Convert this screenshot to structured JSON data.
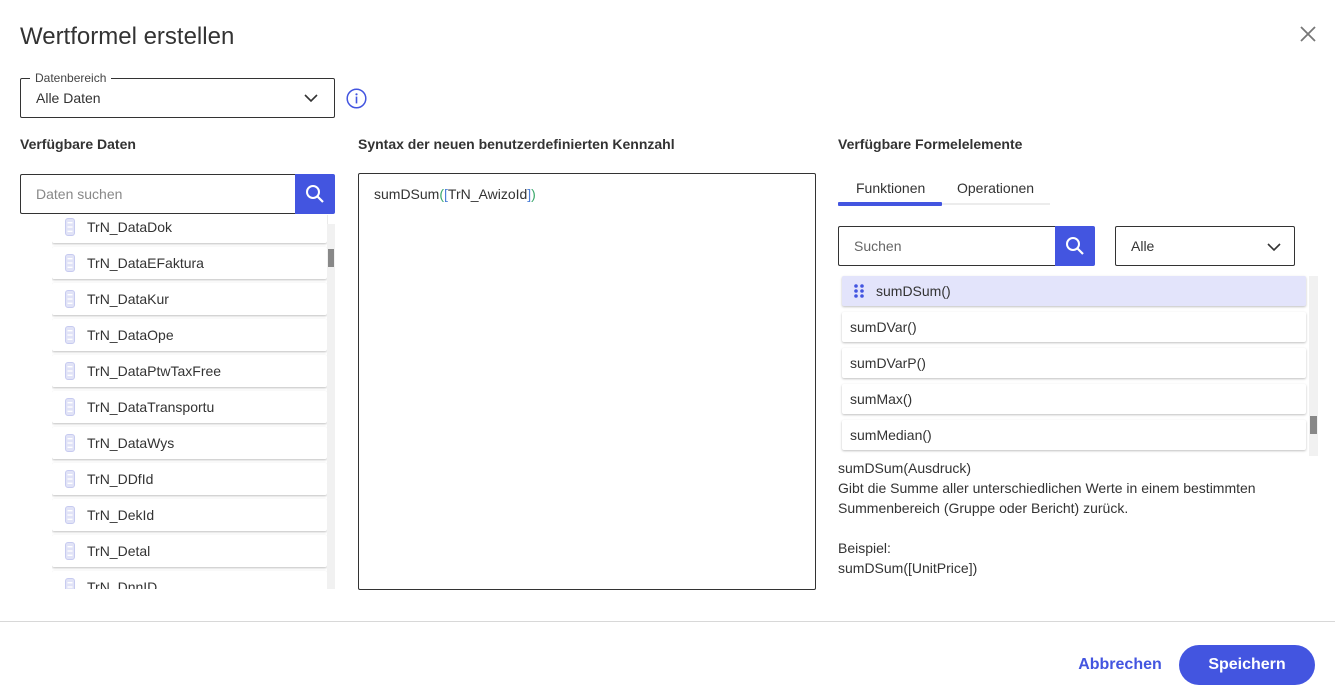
{
  "dialog": {
    "title": "Wertformel erstellen"
  },
  "data_range": {
    "legend": "Datenbereich",
    "value": "Alle Daten"
  },
  "available_data": {
    "label": "Verfügbare Daten",
    "search_placeholder": "Daten suchen",
    "items": [
      "TrN_DataDok",
      "TrN_DataEFaktura",
      "TrN_DataKur",
      "TrN_DataOpe",
      "TrN_DataPtwTaxFree",
      "TrN_DataTransportu",
      "TrN_DataWys",
      "TrN_DDfId",
      "TrN_DekId",
      "TrN_Detal",
      "TrN_DnnID"
    ]
  },
  "syntax": {
    "label": "Syntax der neuen benutzerdefinierten Kennzahl",
    "func": "sumDSum",
    "open_paren": "(",
    "open_bracket": "[",
    "field": "TrN_AwizoId",
    "close_bracket": "]",
    "close_paren": ")"
  },
  "formula_elements": {
    "label": "Verfügbare Formelelemente",
    "tabs": [
      "Funktionen",
      "Operationen"
    ],
    "search_placeholder": "Suchen",
    "filter_value": "Alle",
    "functions": [
      "sumDSum()",
      "sumDVar()",
      "sumDVarP()",
      "sumMax()",
      "sumMedian()"
    ],
    "description": {
      "signature": "sumDSum(Ausdruck)",
      "text_line1": "Gibt die Summe aller unterschiedlichen Werte in einem bestimmten",
      "text_line2": "Summenbereich (Gruppe oder Bericht) zurück.",
      "example_label": "Beispiel:",
      "example": "sumDSum([UnitPrice])"
    }
  },
  "footer": {
    "cancel": "Abbrechen",
    "save": "Speichern"
  },
  "colors": {
    "accent": "#4355e0",
    "selected_row": "#e3e4fb"
  }
}
